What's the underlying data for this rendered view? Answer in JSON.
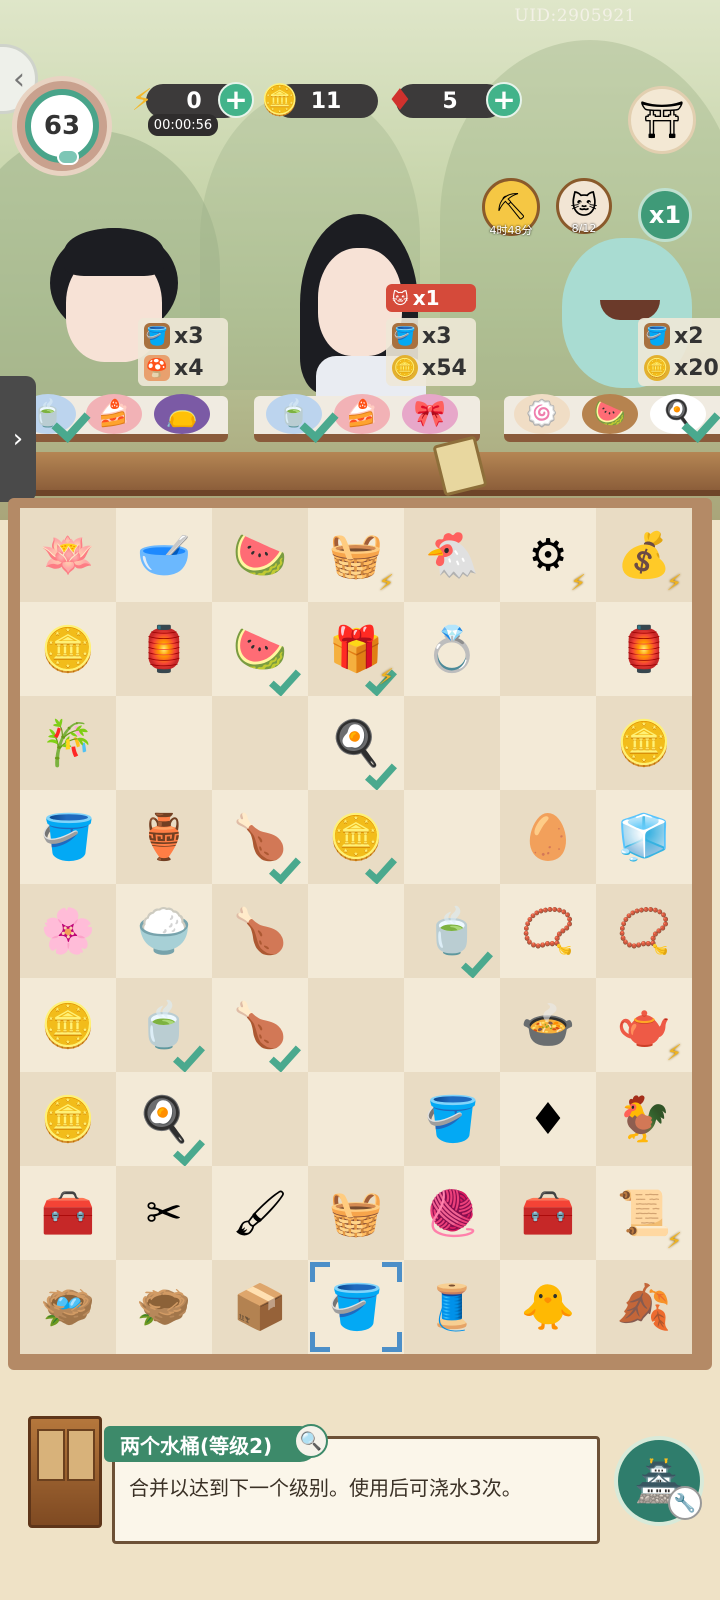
{
  "header": {
    "uid": "UID:2905921",
    "level": "63",
    "energy": {
      "value": "0",
      "timer": "00:00:56",
      "icon": "lightning-icon"
    },
    "coins": {
      "value": "11",
      "icon": "coin-icon"
    },
    "gems": {
      "value": "5",
      "icon": "ruby-icon"
    },
    "event": {
      "timer": "4时48分",
      "icon": "shovel-icon"
    },
    "cat_progress": {
      "text": "8/12",
      "icon": "cat-face-icon"
    },
    "multiplier": "x1"
  },
  "customers": [
    {
      "name": "girl-with-buns",
      "requests": [
        {
          "icon": "bucket-icon",
          "text": "x3"
        },
        {
          "icon": "mushroom-icon",
          "text": "x4"
        }
      ]
    },
    {
      "name": "scholar",
      "bonus": "x1",
      "requests": [
        {
          "icon": "bucket-icon",
          "text": "x3"
        },
        {
          "icon": "coin-icon",
          "text": "x54"
        }
      ]
    },
    {
      "name": "cloud-cat",
      "requests": [
        {
          "icon": "bucket-icon",
          "text": "x2"
        },
        {
          "icon": "coin-icon",
          "text": "x20"
        }
      ]
    }
  ],
  "board": {
    "rows": [
      [
        "🪷",
        "🥣",
        "🍉",
        "🧺",
        "🐔",
        "⚙",
        "💰"
      ],
      [
        "🪙",
        "🏮",
        "🍉",
        "🎁",
        "💍",
        "",
        "🏮"
      ],
      [
        "🎋",
        "",
        "",
        "🍳",
        "",
        "",
        "🪙"
      ],
      [
        "🪣",
        "🏺",
        "🍗",
        "🪙",
        "",
        "🥚",
        "🧊"
      ],
      [
        "🌸",
        "🍚",
        "🍗",
        "",
        "🍵",
        "📿",
        "📿"
      ],
      [
        "🪙",
        "🍵",
        "🍗",
        "",
        "",
        "🍲",
        "🫖"
      ],
      [
        "🪙",
        "🍳",
        "",
        "",
        "🪣",
        "♦",
        "🐓"
      ],
      [
        "🧰",
        "✂",
        "🖌",
        "🧺",
        "🧶",
        "🧰",
        "📜"
      ],
      [
        "🪺",
        "🪹",
        "📦",
        "🪣",
        "🧵",
        "🐥",
        "🍂"
      ]
    ],
    "checks": [
      [
        1,
        2
      ],
      [
        1,
        3
      ],
      [
        2,
        3
      ],
      [
        3,
        2
      ],
      [
        3,
        3
      ],
      [
        4,
        4
      ],
      [
        5,
        1
      ],
      [
        5,
        2
      ],
      [
        6,
        1
      ]
    ],
    "bolts": [
      [
        0,
        3
      ],
      [
        0,
        5
      ],
      [
        0,
        6
      ],
      [
        1,
        3
      ],
      [
        5,
        6
      ],
      [
        7,
        6
      ]
    ],
    "selected": [
      8,
      3
    ]
  },
  "info": {
    "title": "两个水桶(等级2)",
    "description": "合并以达到下一个级别。使用后可浇水3次。",
    "search_icon": "magnifier-icon",
    "action_icon": "pavilion-icon"
  }
}
